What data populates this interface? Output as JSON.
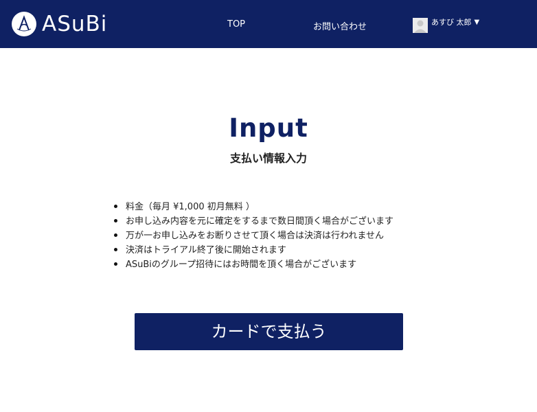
{
  "header": {
    "logo_text": "ASuBi",
    "nav": {
      "top_label": "TOP",
      "contact_label": "お問い合わせ"
    },
    "user": {
      "name": "あすび 太郎",
      "caret": "▼"
    }
  },
  "main": {
    "title": "Input",
    "subtitle": "支払い情報入力",
    "notes": [
      "料金（毎月 ¥1,000 初月無料 ）",
      "お申し込み内容を元に確定をするまで数日間頂く場合がございます",
      "万が一お申し込みをお断りさせて頂く場合は決済は行われません",
      "決済はトライアル終了後に開始されます",
      "ASuBiのグループ招待にはお時間を頂く場合がございます"
    ],
    "pay_button_label": "カードで支払う"
  },
  "colors": {
    "brand": "#0f2163",
    "background": "#ffffff"
  },
  "icons": {
    "logo": "asubi-logo-icon",
    "avatar": "user-avatar-icon",
    "caret": "caret-down-icon"
  }
}
